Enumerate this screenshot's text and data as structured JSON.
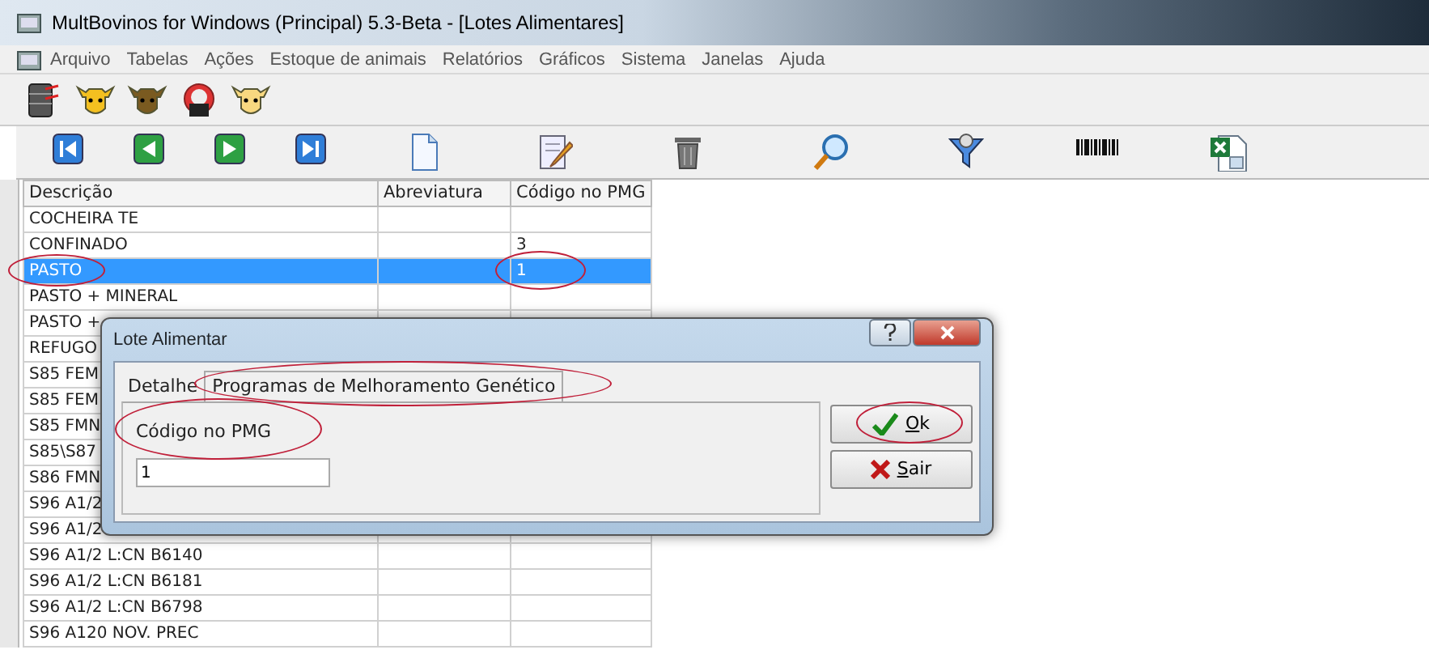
{
  "window": {
    "title": "MultBovinos for Windows (Principal) 5.3-Beta - [Lotes Alimentares]"
  },
  "menu": [
    "Arquivo",
    "Tabelas",
    "Ações",
    "Estoque de animais",
    "Relatórios",
    "Gráficos",
    "Sistema",
    "Janelas",
    "Ajuda"
  ],
  "table": {
    "columns": [
      "Descrição",
      "Abreviatura",
      "Código no PMG"
    ],
    "rows": [
      {
        "cells": [
          "COCHEIRA TE",
          "",
          ""
        ],
        "selected": false,
        "circled": false
      },
      {
        "cells": [
          "CONFINADO",
          "",
          "3"
        ],
        "selected": false,
        "circled": false
      },
      {
        "cells": [
          "PASTO",
          "",
          "1"
        ],
        "selected": true,
        "circled": true
      },
      {
        "cells": [
          "PASTO + MINERAL",
          "",
          ""
        ],
        "selected": false,
        "circled": false
      },
      {
        "cells": [
          "PASTO +",
          "",
          ""
        ],
        "selected": false,
        "circled": false
      },
      {
        "cells": [
          "REFUGO",
          "",
          ""
        ],
        "selected": false,
        "circled": false
      },
      {
        "cells": [
          "S85 FEM",
          "",
          ""
        ],
        "selected": false,
        "circled": false
      },
      {
        "cells": [
          "S85 FEM",
          "",
          ""
        ],
        "selected": false,
        "circled": false
      },
      {
        "cells": [
          "S85 FMN",
          "",
          ""
        ],
        "selected": false,
        "circled": false
      },
      {
        "cells": [
          "S85\\S87",
          "",
          ""
        ],
        "selected": false,
        "circled": false
      },
      {
        "cells": [
          "S86 FMN",
          "",
          ""
        ],
        "selected": false,
        "circled": false
      },
      {
        "cells": [
          "S96 A1/2",
          "",
          ""
        ],
        "selected": false,
        "circled": false
      },
      {
        "cells": [
          "S96 A1/2",
          "",
          ""
        ],
        "selected": false,
        "circled": false
      },
      {
        "cells": [
          "S96 A1/2 L:CN B6140",
          "",
          ""
        ],
        "selected": false,
        "circled": false
      },
      {
        "cells": [
          "S96 A1/2 L:CN B6181",
          "",
          ""
        ],
        "selected": false,
        "circled": false
      },
      {
        "cells": [
          "S96 A1/2 L:CN B6798",
          "",
          ""
        ],
        "selected": false,
        "circled": false
      },
      {
        "cells": [
          "S96 A120 NOV. PREC",
          "",
          ""
        ],
        "selected": false,
        "circled": false
      }
    ]
  },
  "dialog": {
    "title": "Lote Alimentar",
    "tabs": [
      {
        "label": "Detalhe",
        "selected": false,
        "circled": false
      },
      {
        "label": "Programas de Melhoramento Genético",
        "selected": true,
        "circled": true
      }
    ],
    "field": {
      "label": "Código no PMG",
      "value": "1",
      "circled": true
    },
    "buttons": [
      {
        "label": "Ok",
        "kind": "ok",
        "circled": true
      },
      {
        "label": "Sair",
        "kind": "exit",
        "circled": false
      }
    ]
  }
}
